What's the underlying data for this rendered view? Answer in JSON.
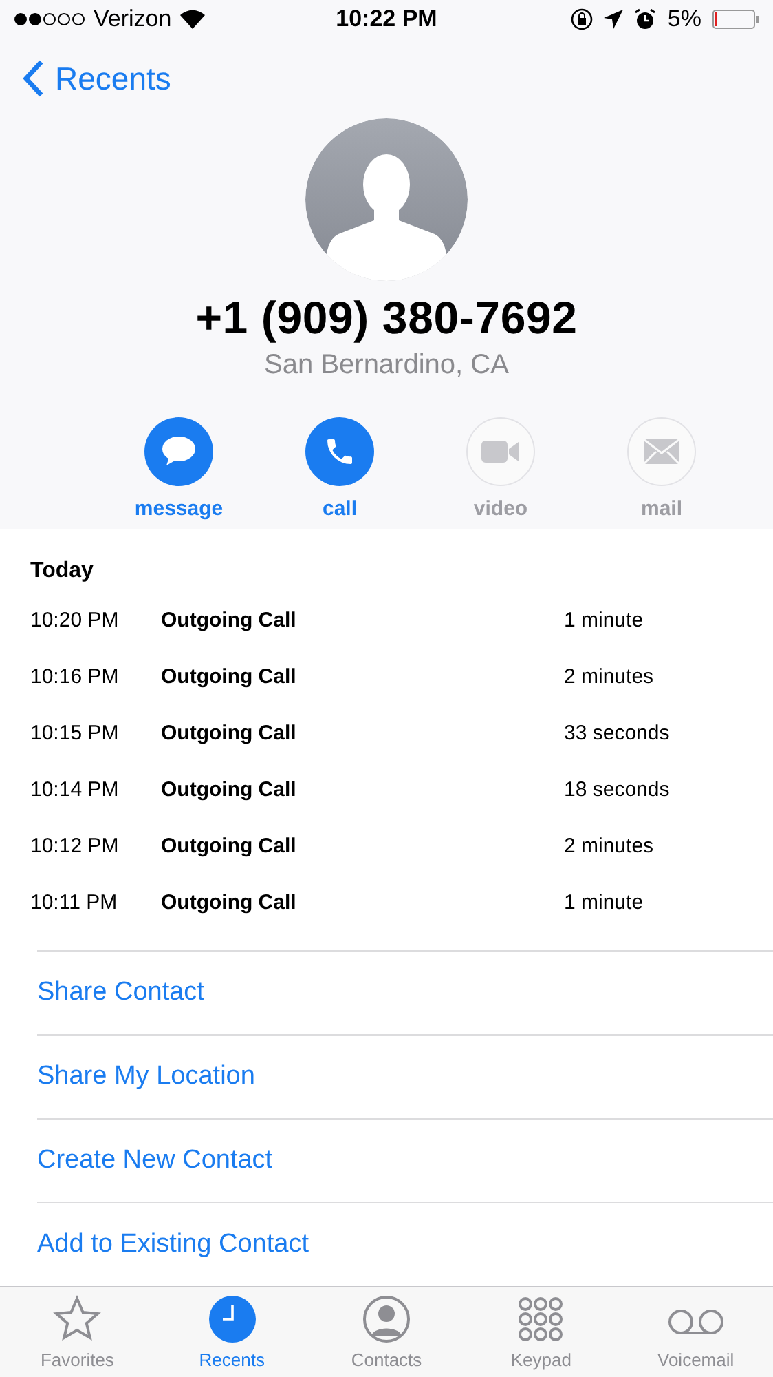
{
  "status_bar": {
    "carrier": "Verizon",
    "time": "10:22 PM",
    "battery": "5%"
  },
  "nav": {
    "back": "Recents"
  },
  "contact": {
    "number": "+1 (909) 380-7692",
    "location": "San Bernardino, CA"
  },
  "actions": [
    {
      "label": "message",
      "enabled": true
    },
    {
      "label": "call",
      "enabled": true
    },
    {
      "label": "video",
      "enabled": false
    },
    {
      "label": "mail",
      "enabled": false
    }
  ],
  "history": {
    "heading": "Today",
    "rows": [
      {
        "time": "10:20 PM",
        "type": "Outgoing Call",
        "duration": "1 minute"
      },
      {
        "time": "10:16 PM",
        "type": "Outgoing Call",
        "duration": "2 minutes"
      },
      {
        "time": "10:15 PM",
        "type": "Outgoing Call",
        "duration": "33 seconds"
      },
      {
        "time": "10:14 PM",
        "type": "Outgoing Call",
        "duration": "18 seconds"
      },
      {
        "time": "10:12 PM",
        "type": "Outgoing Call",
        "duration": "2 minutes"
      },
      {
        "time": "10:11 PM",
        "type": "Outgoing Call",
        "duration": "1 minute"
      }
    ]
  },
  "links": [
    "Share Contact",
    "Share My Location",
    "Create New Contact",
    "Add to Existing Contact"
  ],
  "tab_bar": [
    {
      "label": "Favorites",
      "selected": false
    },
    {
      "label": "Recents",
      "selected": true
    },
    {
      "label": "Contacts",
      "selected": false
    },
    {
      "label": "Keypad",
      "selected": false
    },
    {
      "label": "Voicemail",
      "selected": false
    }
  ]
}
